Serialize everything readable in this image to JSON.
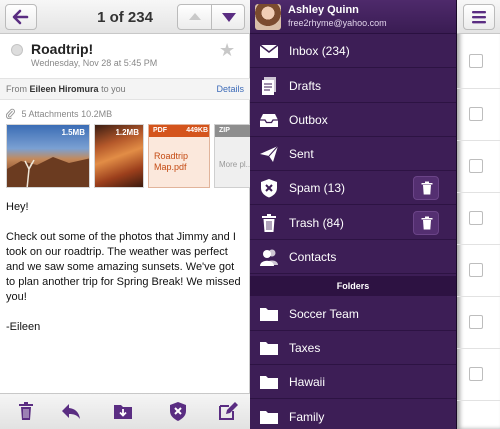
{
  "colors": {
    "accent": "#5a2d82",
    "sidebar_bg": "#3d1e56",
    "link": "#3d6bb8",
    "pdf": "#d4541c"
  },
  "email": {
    "counter": "1 of 234",
    "subject": "Roadtrip!",
    "date": "Wednesday, Nov 28 at 5:45 PM",
    "from_prefix": "From",
    "from_name": "Eileen Hiromura",
    "from_suffix": "to you",
    "details_label": "Details",
    "attachments_summary": "5 Attachments",
    "attachments_total": "10.2MB",
    "attachments": [
      {
        "kind": "photo",
        "size": "1.5MB"
      },
      {
        "kind": "photo",
        "size": "1.2MB"
      },
      {
        "kind": "PDF",
        "size": "449KB",
        "name": "Roadtrip Map.pdf"
      },
      {
        "kind": "ZIP",
        "name": "More pl... videos..."
      }
    ],
    "body": [
      "Hey!",
      "Check out some of the photos that Jimmy and I took on our roadtrip. The weather was perfect and we saw some amazing sunsets. We've got to plan another trip for Spring Break! We missed you!",
      "-Eileen"
    ],
    "toolbar_icons": [
      "trash-icon",
      "reply-icon",
      "move-folder-icon",
      "spam-shield-icon",
      "compose-icon"
    ]
  },
  "sidebar": {
    "user_name": "Ashley Quinn",
    "user_email": "free2rhyme@yahoo.com",
    "items": [
      {
        "label": "Inbox (234)",
        "icon": "inbox-icon"
      },
      {
        "label": "Drafts",
        "icon": "drafts-icon"
      },
      {
        "label": "Outbox",
        "icon": "outbox-icon"
      },
      {
        "label": "Sent",
        "icon": "sent-icon"
      },
      {
        "label": "Spam (13)",
        "icon": "spam-icon"
      },
      {
        "label": "Trash (84)",
        "icon": "trash-icon"
      },
      {
        "label": "Contacts",
        "icon": "contacts-icon"
      }
    ],
    "folders_header": "Folders",
    "folders": [
      "Soccer Team",
      "Taxes",
      "Hawaii",
      "Family"
    ]
  }
}
